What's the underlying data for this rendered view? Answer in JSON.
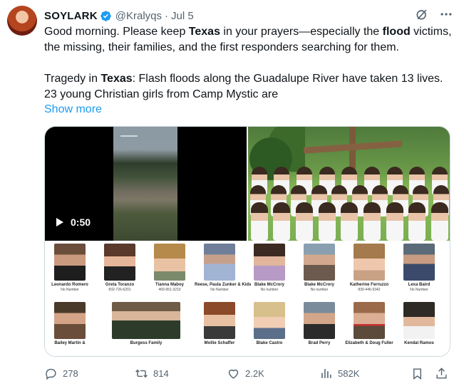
{
  "author": {
    "display_name": "SOYLARK",
    "handle": "@Kralyqs",
    "separator": "·",
    "date": "Jul 5",
    "verified_color": "#1d9bf0"
  },
  "tweet": {
    "p1_a": "Good morning. Please keep ",
    "p1_b": "Texas",
    "p1_c": " in your prayers—especially the ",
    "p1_d": "flood",
    "p1_e": " victims, the missing, their families, and the first responders searching for them.",
    "p2_a": "Tragedy in ",
    "p2_b": "Texas",
    "p2_c": ": Flash floods along the Guadalupe River have taken 13 lives. 23 young Christian girls from Camp Mystic are",
    "show_more": "Show more"
  },
  "media": {
    "video_duration": "0:50",
    "missing_people": [
      {
        "name": "Leonardo Romero",
        "phone": "No Number"
      },
      {
        "name": "Greta Toranzo",
        "phone": "832-726-6201"
      },
      {
        "name": "Tianna Maboy",
        "phone": "469-951-3210"
      },
      {
        "name": "Reese, Paula Zunker & Kids",
        "phone": "No Number"
      },
      {
        "name": "Blake McCrory",
        "phone": "No number"
      },
      {
        "name": "Blake McCrory",
        "phone": "No number"
      },
      {
        "name": "Katherine Ferruzzo",
        "phone": "830-446-9342"
      },
      {
        "name": "Lexa Baird",
        "phone": "No Number"
      },
      {
        "name": "Bailey Martin &",
        "phone": ""
      },
      {
        "name": "Burgess Family",
        "phone": ""
      },
      {
        "name": "Mollie Schaffer",
        "phone": ""
      },
      {
        "name": "Blake Castro",
        "phone": ""
      },
      {
        "name": "Brad Perry",
        "phone": ""
      },
      {
        "name": "Elizabeth & Doug Fuller",
        "phone": ""
      },
      {
        "name": "Kendal Ramos",
        "phone": ""
      }
    ]
  },
  "stats": {
    "replies": "278",
    "retweets": "814",
    "likes": "2.2K",
    "views": "582K"
  },
  "colors": {
    "accent": "#1d9bf0",
    "secondary_text": "#536471",
    "primary_text": "#0f1419"
  }
}
